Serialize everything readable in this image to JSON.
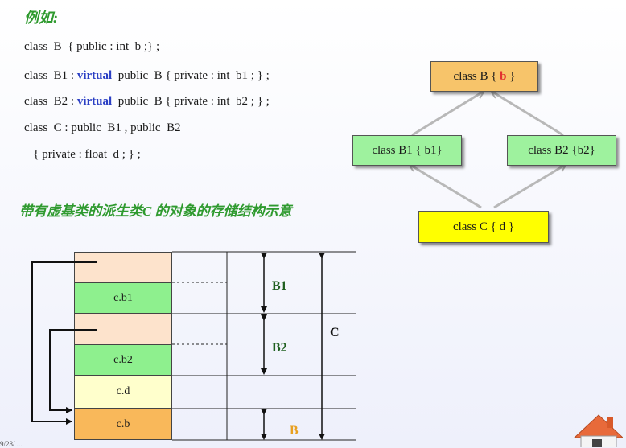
{
  "heading": "例如:",
  "code": {
    "line1": "class  B  { public : int  b ;} ;",
    "line2_pre": "class  B1 : ",
    "line2_kw": "virtual",
    "line2_post": "  public  B { private : int  b1 ; } ;",
    "line3_pre": "class  B2 : ",
    "line3_kw": "virtual",
    "line3_post": "  public  B { private : int  b2 ; } ;",
    "line4": "class  C : public  B1 , public  B2",
    "line5": "   { private : float  d ; } ;"
  },
  "caption": "带有虚基类的派生类C 的对象的存储结构示意",
  "hierarchy": {
    "b_pre": "class B { ",
    "b_member": "b",
    "b_post": " }",
    "b1": "class B1 { b1}",
    "b2": "class B2 {b2}",
    "c": "class C { d }"
  },
  "layout": {
    "cells": [
      "c.b1",
      "c.b2",
      "c.d",
      "c.b"
    ],
    "labels": {
      "b1": "B1",
      "b2": "B2",
      "b": "B",
      "c": "C"
    }
  },
  "footer": "9/28/ ...",
  "colors": {
    "green_text": "#2f9a2f",
    "keyword": "#2b3fc4",
    "class_b_fill": "#f7c46a",
    "class_b1_b2_fill": "#9ef29e",
    "class_c_fill": "#ffff00",
    "cell_peach": "#fde3cc",
    "cell_green": "#8ef08e",
    "cell_yellow": "#ffffcc",
    "cell_orange": "#f9b85a"
  },
  "icons": [
    "home-icon"
  ]
}
